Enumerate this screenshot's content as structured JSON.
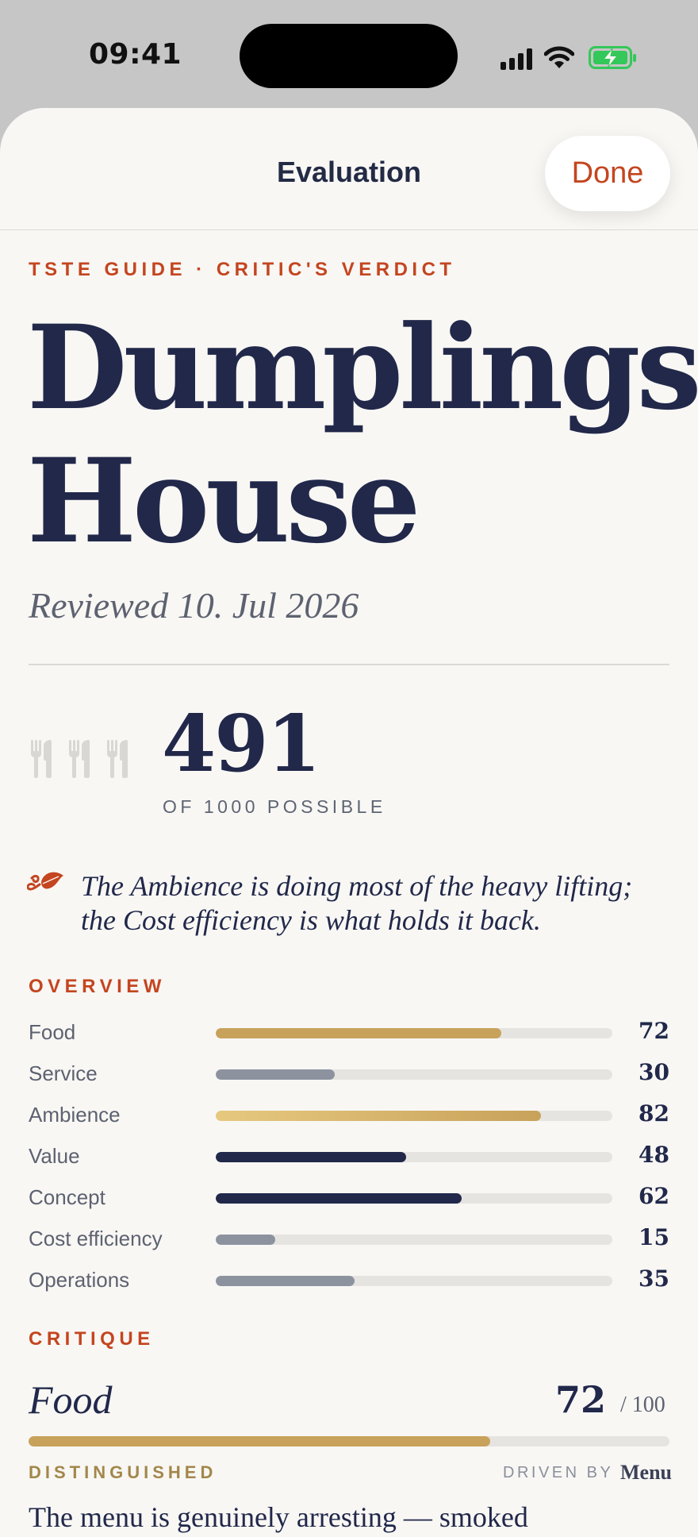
{
  "status_bar": {
    "time": "09:41",
    "icons": [
      "cellular-signal-icon",
      "wifi-icon",
      "battery-charging-icon"
    ],
    "battery_color": "#34c759"
  },
  "sheet": {
    "title": "Evaluation",
    "done_label": "Done"
  },
  "colors": {
    "accent": "#c4451f",
    "navy": "#21284a",
    "gold": "#c8a25a",
    "light_gold": "#e6c97e",
    "slate": "#8c939f",
    "muted_text": "#5d6270"
  },
  "review": {
    "kicker": "TSTE GUIDE · CRITIC'S VERDICT",
    "restaurant_name_line1": "Dumplings",
    "restaurant_name_line2": "House",
    "reviewed_date": "Reviewed 10. Jul 2026",
    "score": "491",
    "score_caption": "OF 1000 POSSIBLE",
    "fork_icons": [
      "fork-knife-icon",
      "fork-knife-icon",
      "fork-knife-icon"
    ],
    "verdict_icon": "leaf-icon",
    "verdict": "The Ambience is doing most of the heavy lifting; the Cost efficiency is what holds it back."
  },
  "overview": {
    "label": "OVERVIEW",
    "rows": [
      {
        "label": "Food",
        "value": "72",
        "fraction": 0.72,
        "style": "gold"
      },
      {
        "label": "Service",
        "value": "30",
        "fraction": 0.3,
        "style": "slate"
      },
      {
        "label": "Ambience",
        "value": "82",
        "fraction": 0.82,
        "style": "lightgold"
      },
      {
        "label": "Value",
        "value": "48",
        "fraction": 0.48,
        "style": "navy"
      },
      {
        "label": "Concept",
        "value": "62",
        "fraction": 0.62,
        "style": "navy"
      },
      {
        "label": "Cost efficiency",
        "value": "15",
        "fraction": 0.15,
        "style": "slate"
      },
      {
        "label": "Operations",
        "value": "35",
        "fraction": 0.35,
        "style": "slate"
      }
    ]
  },
  "critique": {
    "label": "CRITIQUE",
    "items": [
      {
        "title": "Food",
        "score": "72",
        "max": "/ 100",
        "fraction": 0.72,
        "tier": "DISTINGUISHED",
        "driven_by_label": "DRIVEN BY",
        "driven_by": "Menu",
        "body": "The menu is genuinely arresting — smoked"
      }
    ]
  }
}
